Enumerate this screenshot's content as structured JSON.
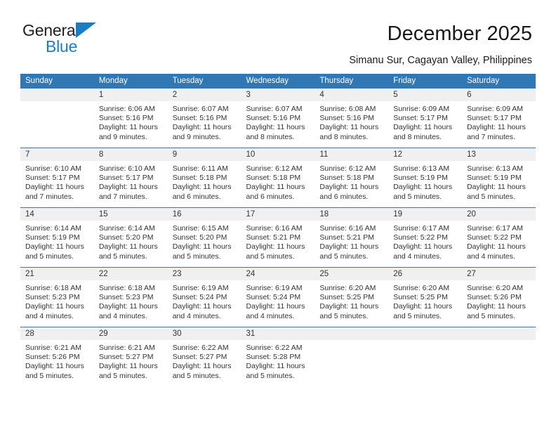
{
  "brand": {
    "name_top": "General",
    "name_bottom": "Blue",
    "accent_color": "#1a7dc4"
  },
  "header": {
    "title": "December 2025",
    "subtitle": "Simanu Sur, Cagayan Valley, Philippines"
  },
  "theme": {
    "header_blue": "#2f77b5",
    "daynum_band": "#f0f0f0",
    "text": "#333333"
  },
  "weekdays": [
    "Sunday",
    "Monday",
    "Tuesday",
    "Wednesday",
    "Thursday",
    "Friday",
    "Saturday"
  ],
  "weeks": [
    [
      {
        "day": "",
        "sunrise": "",
        "sunset": "",
        "daylight": ""
      },
      {
        "day": "1",
        "sunrise": "Sunrise: 6:06 AM",
        "sunset": "Sunset: 5:16 PM",
        "daylight": "Daylight: 11 hours and 9 minutes."
      },
      {
        "day": "2",
        "sunrise": "Sunrise: 6:07 AM",
        "sunset": "Sunset: 5:16 PM",
        "daylight": "Daylight: 11 hours and 9 minutes."
      },
      {
        "day": "3",
        "sunrise": "Sunrise: 6:07 AM",
        "sunset": "Sunset: 5:16 PM",
        "daylight": "Daylight: 11 hours and 8 minutes."
      },
      {
        "day": "4",
        "sunrise": "Sunrise: 6:08 AM",
        "sunset": "Sunset: 5:16 PM",
        "daylight": "Daylight: 11 hours and 8 minutes."
      },
      {
        "day": "5",
        "sunrise": "Sunrise: 6:09 AM",
        "sunset": "Sunset: 5:17 PM",
        "daylight": "Daylight: 11 hours and 8 minutes."
      },
      {
        "day": "6",
        "sunrise": "Sunrise: 6:09 AM",
        "sunset": "Sunset: 5:17 PM",
        "daylight": "Daylight: 11 hours and 7 minutes."
      }
    ],
    [
      {
        "day": "7",
        "sunrise": "Sunrise: 6:10 AM",
        "sunset": "Sunset: 5:17 PM",
        "daylight": "Daylight: 11 hours and 7 minutes."
      },
      {
        "day": "8",
        "sunrise": "Sunrise: 6:10 AM",
        "sunset": "Sunset: 5:17 PM",
        "daylight": "Daylight: 11 hours and 7 minutes."
      },
      {
        "day": "9",
        "sunrise": "Sunrise: 6:11 AM",
        "sunset": "Sunset: 5:18 PM",
        "daylight": "Daylight: 11 hours and 6 minutes."
      },
      {
        "day": "10",
        "sunrise": "Sunrise: 6:12 AM",
        "sunset": "Sunset: 5:18 PM",
        "daylight": "Daylight: 11 hours and 6 minutes."
      },
      {
        "day": "11",
        "sunrise": "Sunrise: 6:12 AM",
        "sunset": "Sunset: 5:18 PM",
        "daylight": "Daylight: 11 hours and 6 minutes."
      },
      {
        "day": "12",
        "sunrise": "Sunrise: 6:13 AM",
        "sunset": "Sunset: 5:19 PM",
        "daylight": "Daylight: 11 hours and 5 minutes."
      },
      {
        "day": "13",
        "sunrise": "Sunrise: 6:13 AM",
        "sunset": "Sunset: 5:19 PM",
        "daylight": "Daylight: 11 hours and 5 minutes."
      }
    ],
    [
      {
        "day": "14",
        "sunrise": "Sunrise: 6:14 AM",
        "sunset": "Sunset: 5:19 PM",
        "daylight": "Daylight: 11 hours and 5 minutes."
      },
      {
        "day": "15",
        "sunrise": "Sunrise: 6:14 AM",
        "sunset": "Sunset: 5:20 PM",
        "daylight": "Daylight: 11 hours and 5 minutes."
      },
      {
        "day": "16",
        "sunrise": "Sunrise: 6:15 AM",
        "sunset": "Sunset: 5:20 PM",
        "daylight": "Daylight: 11 hours and 5 minutes."
      },
      {
        "day": "17",
        "sunrise": "Sunrise: 6:16 AM",
        "sunset": "Sunset: 5:21 PM",
        "daylight": "Daylight: 11 hours and 5 minutes."
      },
      {
        "day": "18",
        "sunrise": "Sunrise: 6:16 AM",
        "sunset": "Sunset: 5:21 PM",
        "daylight": "Daylight: 11 hours and 5 minutes."
      },
      {
        "day": "19",
        "sunrise": "Sunrise: 6:17 AM",
        "sunset": "Sunset: 5:22 PM",
        "daylight": "Daylight: 11 hours and 4 minutes."
      },
      {
        "day": "20",
        "sunrise": "Sunrise: 6:17 AM",
        "sunset": "Sunset: 5:22 PM",
        "daylight": "Daylight: 11 hours and 4 minutes."
      }
    ],
    [
      {
        "day": "21",
        "sunrise": "Sunrise: 6:18 AM",
        "sunset": "Sunset: 5:23 PM",
        "daylight": "Daylight: 11 hours and 4 minutes."
      },
      {
        "day": "22",
        "sunrise": "Sunrise: 6:18 AM",
        "sunset": "Sunset: 5:23 PM",
        "daylight": "Daylight: 11 hours and 4 minutes."
      },
      {
        "day": "23",
        "sunrise": "Sunrise: 6:19 AM",
        "sunset": "Sunset: 5:24 PM",
        "daylight": "Daylight: 11 hours and 4 minutes."
      },
      {
        "day": "24",
        "sunrise": "Sunrise: 6:19 AM",
        "sunset": "Sunset: 5:24 PM",
        "daylight": "Daylight: 11 hours and 4 minutes."
      },
      {
        "day": "25",
        "sunrise": "Sunrise: 6:20 AM",
        "sunset": "Sunset: 5:25 PM",
        "daylight": "Daylight: 11 hours and 5 minutes."
      },
      {
        "day": "26",
        "sunrise": "Sunrise: 6:20 AM",
        "sunset": "Sunset: 5:25 PM",
        "daylight": "Daylight: 11 hours and 5 minutes."
      },
      {
        "day": "27",
        "sunrise": "Sunrise: 6:20 AM",
        "sunset": "Sunset: 5:26 PM",
        "daylight": "Daylight: 11 hours and 5 minutes."
      }
    ],
    [
      {
        "day": "28",
        "sunrise": "Sunrise: 6:21 AM",
        "sunset": "Sunset: 5:26 PM",
        "daylight": "Daylight: 11 hours and 5 minutes."
      },
      {
        "day": "29",
        "sunrise": "Sunrise: 6:21 AM",
        "sunset": "Sunset: 5:27 PM",
        "daylight": "Daylight: 11 hours and 5 minutes."
      },
      {
        "day": "30",
        "sunrise": "Sunrise: 6:22 AM",
        "sunset": "Sunset: 5:27 PM",
        "daylight": "Daylight: 11 hours and 5 minutes."
      },
      {
        "day": "31",
        "sunrise": "Sunrise: 6:22 AM",
        "sunset": "Sunset: 5:28 PM",
        "daylight": "Daylight: 11 hours and 5 minutes."
      },
      {
        "day": "",
        "sunrise": "",
        "sunset": "",
        "daylight": ""
      },
      {
        "day": "",
        "sunrise": "",
        "sunset": "",
        "daylight": ""
      },
      {
        "day": "",
        "sunrise": "",
        "sunset": "",
        "daylight": ""
      }
    ]
  ]
}
